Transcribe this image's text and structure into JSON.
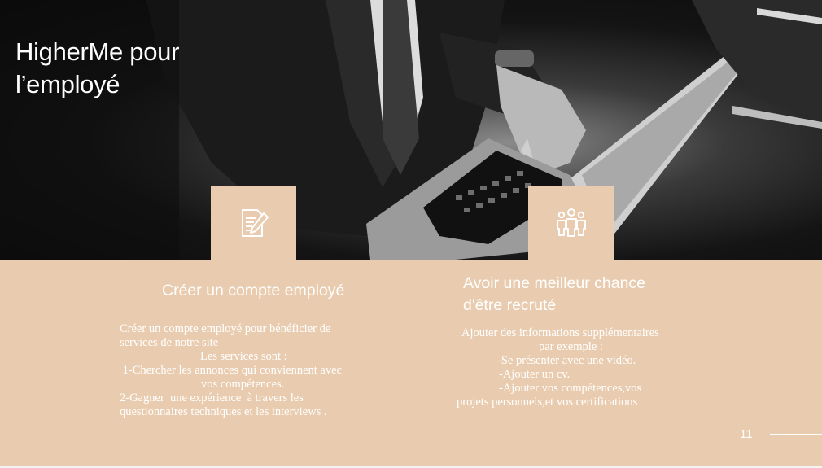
{
  "slide": {
    "title_line1": "HigherMe pour",
    "title_line2": "l’employé",
    "page_number": "11"
  },
  "card_left": {
    "icon": "document-edit-icon",
    "heading": "Créer un compte employé",
    "lines": [
      "Créer un compte employé pour bénéficier de",
      "services de notre site",
      "Les services sont :",
      " 1-Chercher les annonces qui conviennent avec",
      "vos compétences.",
      "2-Gagner  une expérience  à travers les",
      "questionnaires techniques et les interviews ."
    ]
  },
  "card_right": {
    "icon": "group-people-icon",
    "heading_line1": "Avoir une meilleur chance",
    "heading_line2": "d'être recruté",
    "lines": [
      "Ajouter des informations supplémentaires",
      "par exemple :",
      "-Se présenter avec une vidéo.",
      "-Ajouter un cv.",
      "-Ajouter vos compétences,vos",
      "projets personnels,et vos certifications"
    ]
  },
  "colors": {
    "accent": "#e9ccaf",
    "text": "#ffffff"
  }
}
